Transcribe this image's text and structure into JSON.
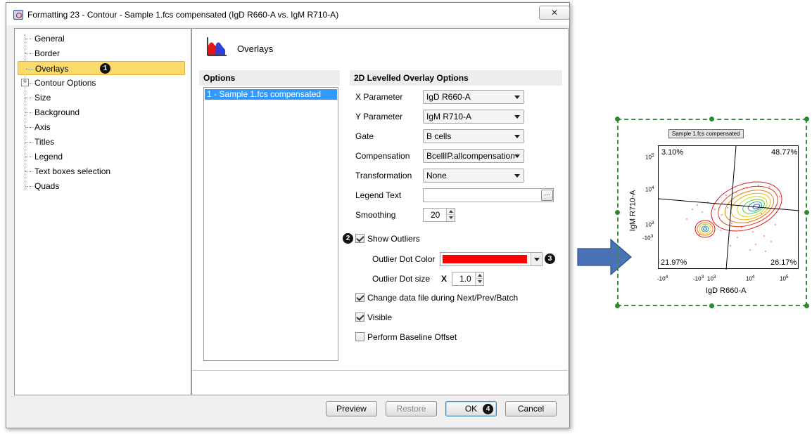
{
  "window": {
    "title": "Formatting 23 - Contour - Sample 1.fcs compensated (IgD R660-A vs. IgM R710-A)",
    "close_label": "✕"
  },
  "nav": {
    "items": [
      {
        "label": "General"
      },
      {
        "label": "Border"
      },
      {
        "label": "Overlays"
      },
      {
        "label": "Contour Options"
      },
      {
        "label": "Size"
      },
      {
        "label": "Background"
      },
      {
        "label": "Axis"
      },
      {
        "label": "Titles"
      },
      {
        "label": "Legend"
      },
      {
        "label": "Text boxes selection"
      },
      {
        "label": "Quads"
      }
    ],
    "selected_index": 2
  },
  "badges": [
    "1",
    "2",
    "3",
    "4"
  ],
  "content": {
    "page_title": "Overlays",
    "options_header": "Options",
    "options_items": [
      "1 - Sample 1.fcs compensated"
    ],
    "section_header": "2D Levelled Overlay Options",
    "fields": {
      "x_parameter": {
        "label": "X Parameter",
        "value": "IgD R660-A"
      },
      "y_parameter": {
        "label": "Y Parameter",
        "value": "IgM R710-A"
      },
      "gate": {
        "label": "Gate",
        "value": "B cells"
      },
      "compensation": {
        "label": "Compensation",
        "value": "BcellIP.allcompensation"
      },
      "transformation": {
        "label": "Transformation",
        "value": "None"
      },
      "legend_text": {
        "label": "Legend Text",
        "value": "",
        "browse_label": "..."
      },
      "smoothing": {
        "label": "Smoothing",
        "value": "20"
      }
    },
    "show_outliers": {
      "label": "Show Outliers",
      "checked": true
    },
    "outlier_dot_color": {
      "label": "Outlier Dot Color",
      "color": "#ff0000"
    },
    "outlier_dot_size": {
      "label": "Outlier Dot size",
      "prefix": "X",
      "value": "1.0"
    },
    "change_data_file": {
      "label": "Change data file during Next/Prev/Batch",
      "checked": true
    },
    "visible": {
      "label": "Visible",
      "checked": true
    },
    "baseline_offset": {
      "label": "Perform Baseline Offset",
      "checked": false
    }
  },
  "footer": {
    "preview": "Preview",
    "restore": "Restore",
    "ok": "OK",
    "cancel": "Cancel"
  },
  "plot": {
    "sample_label": "Sample 1.fcs compensated",
    "quadrants": {
      "top_left": "3.10%",
      "top_right": "48.77%",
      "bottom_left": "21.97%",
      "bottom_right": "26.17%"
    },
    "x_axis_title": "IgD R660-A",
    "y_axis_title": "IgM R710-A",
    "x_ticks": [
      {
        "base": "-10",
        "exp": "4"
      },
      {
        "base": "-10",
        "exp": "3"
      },
      {
        "base": "10",
        "exp": "3"
      },
      {
        "base": "10",
        "exp": "4"
      },
      {
        "base": "10",
        "exp": "5"
      }
    ],
    "y_ticks": [
      {
        "base": "10",
        "exp": "5"
      },
      {
        "base": "10",
        "exp": "4"
      },
      {
        "base": "10",
        "exp": "3"
      },
      {
        "base": "-10",
        "exp": "3"
      }
    ]
  },
  "colors": {
    "selection": "#fbd96a",
    "list_selection": "#3399ff",
    "arrow": "#4a73b6",
    "frame": "#3c8a3c"
  }
}
